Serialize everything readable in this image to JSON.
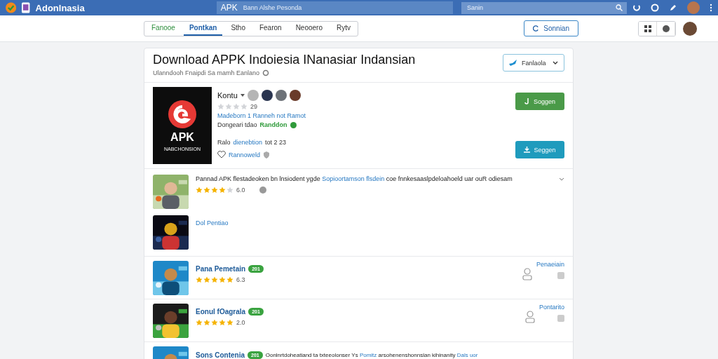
{
  "topbar": {
    "brand": "Adonlnasia",
    "prefix": "APK",
    "address": "Bann Alshe Pesonda",
    "search": {
      "placeholder": "Sanin"
    }
  },
  "nav": {
    "tabs": [
      {
        "label": "Fanooe",
        "selected": false
      },
      {
        "label": "Pontkan",
        "selected": true
      },
      {
        "label": "Stho",
        "selected": false
      },
      {
        "label": "Fearon",
        "selected": false
      },
      {
        "label": "Neooero",
        "selected": false
      },
      {
        "label": "Rytv",
        "selected": false
      }
    ],
    "action": "Sonnian"
  },
  "header": {
    "title": "Download APPK Indoiesia INanasiar Indansian",
    "subtitle": "Ulanndooh Fnaipdi Sa mamh Eanlano",
    "dropdown": "Fanlaola"
  },
  "app": {
    "logo_text": "APK",
    "logo_caption": "NABCHONSION",
    "name": "Kontu",
    "stars": 0,
    "rating": "29",
    "link": "Madeborn 1 Ranneh not Ramot",
    "meta_label": "Dongeari tdao",
    "meta_value": "Randdon",
    "release": "Ralo",
    "release_link": "dienebtion",
    "release_suffix": "tot 2 23",
    "favorite": "Rannoweld",
    "primary_button": "Soggen",
    "secondary_button": "Seggen"
  },
  "review": {
    "text_start": "Pannad APK flestadeoken bn lnsiodent ygde",
    "text_link": "Sopioortamson flsdein",
    "text_end": "coe fnnkesaaslpdeloahoeld uar ouR odiesam",
    "stars": 4,
    "rating": "6.0",
    "thumb_link": "Dol Pentiao"
  },
  "rows": [
    {
      "kind": "side",
      "name": "Pana Pemetain",
      "badge": "201",
      "stars": 5,
      "rating": "6.3",
      "side": "Penaeiain"
    },
    {
      "kind": "side",
      "name": "Eonul fOagrala",
      "badge": "201",
      "stars": 5,
      "rating": "2.0",
      "side": "Pontarito"
    },
    {
      "kind": "desc",
      "name": "Sons Contenia",
      "badge": "201",
      "text": "Oonlnrtdoheatiand ta txteeolonser Ys",
      "text_link": "Pomitz",
      "text_end": "arsohenenshonnslan kihinanity",
      "end_link": "Dals uor"
    }
  ]
}
